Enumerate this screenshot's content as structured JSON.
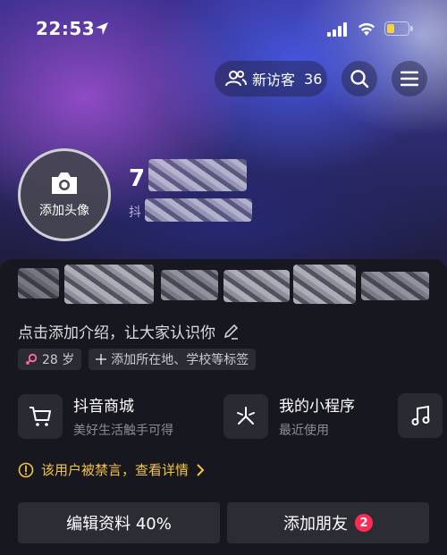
{
  "status_bar": {
    "time": "22:53",
    "battery_color": "#f7d23b"
  },
  "header": {
    "visitors_label": "新访客",
    "visitors_count": "36"
  },
  "profile": {
    "avatar_label": "添加头像",
    "name_visible": "7",
    "sub_visible": "抖"
  },
  "bio": {
    "placeholder": "点击添加介绍，让大家认识你"
  },
  "tags": [
    {
      "label": "28 岁"
    },
    {
      "label": "添加所在地、学校等标签"
    }
  ],
  "shortcuts": [
    {
      "title": "抖音商城",
      "subtitle": "美好生活触手可得",
      "icon": "cart-icon"
    },
    {
      "title": "我的小程序",
      "subtitle": "最近使用",
      "icon": "mini-program-icon"
    },
    {
      "title": "",
      "subtitle": "",
      "icon": "music-icon"
    }
  ],
  "warning": {
    "text": "该用户被禁言，查看详情"
  },
  "actions": {
    "edit_label": "编辑资料 40%",
    "add_friend_label": "添加朋友",
    "add_friend_badge": "2"
  },
  "colors": {
    "accent": "#fe2c55",
    "warning": "#f4c63d",
    "panel": "#17171f"
  }
}
